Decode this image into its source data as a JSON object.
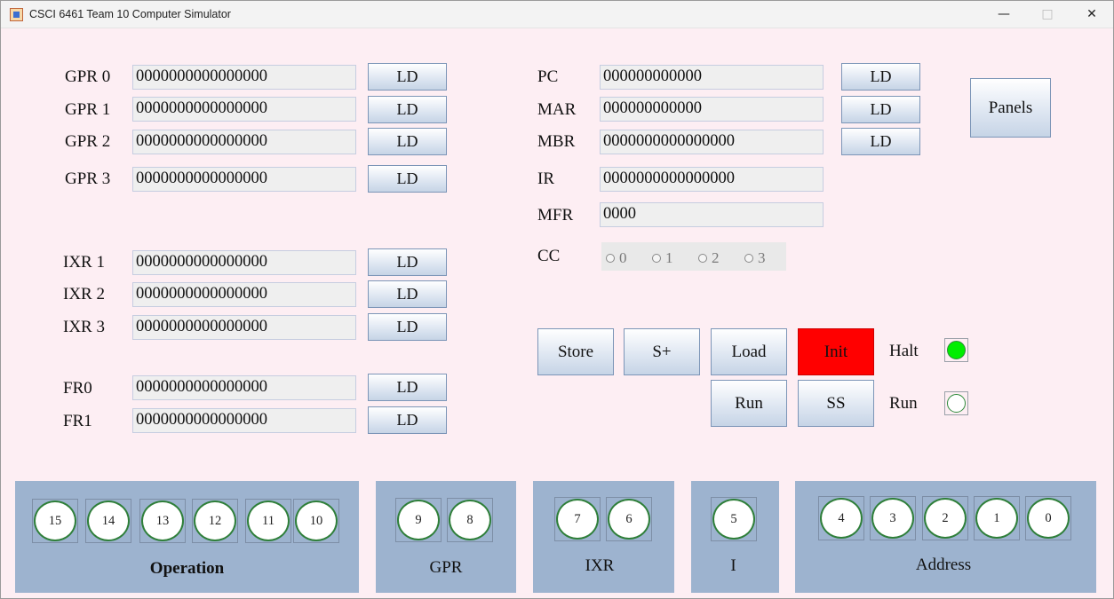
{
  "window": {
    "title": "CSCI 6461 Team 10 Computer Simulator"
  },
  "window_controls": {
    "minimize": "—",
    "maximize": "□",
    "close": "✕"
  },
  "registers_left": [
    {
      "label": "GPR 0",
      "value": "0000000000000000",
      "button": "LD"
    },
    {
      "label": "GPR 1",
      "value": "0000000000000000",
      "button": "LD"
    },
    {
      "label": "GPR 2",
      "value": "0000000000000000",
      "button": "LD"
    },
    {
      "label": "GPR 3",
      "value": "0000000000000000",
      "button": "LD"
    },
    {
      "label": "IXR 1",
      "value": "0000000000000000",
      "button": "LD"
    },
    {
      "label": "IXR 2",
      "value": "0000000000000000",
      "button": "LD"
    },
    {
      "label": "IXR 3",
      "value": "0000000000000000",
      "button": "LD"
    },
    {
      "label": "FR0",
      "value": "0000000000000000",
      "button": "LD"
    },
    {
      "label": "FR1",
      "value": "0000000000000000",
      "button": "LD"
    }
  ],
  "registers_right": [
    {
      "label": "PC",
      "value": "000000000000",
      "button": "LD"
    },
    {
      "label": "MAR",
      "value": "000000000000",
      "button": "LD"
    },
    {
      "label": "MBR",
      "value": "0000000000000000",
      "button": "LD"
    },
    {
      "label": "IR",
      "value": "0000000000000000"
    },
    {
      "label": "MFR",
      "value": "0000"
    }
  ],
  "cc": {
    "label": "CC",
    "options": [
      "0",
      "1",
      "2",
      "3"
    ]
  },
  "panels_button": "Panels",
  "controls": {
    "store": "Store",
    "sp": "S+",
    "load": "Load",
    "init": "Init",
    "run": "Run",
    "ss": "SS"
  },
  "indicators": {
    "halt": {
      "label": "Halt",
      "on": true,
      "color": "#00ee00"
    },
    "run": {
      "label": "Run",
      "on": false,
      "color": "#ffffff"
    }
  },
  "switch_panels": [
    {
      "caption": "Operation",
      "bits": [
        "15",
        "14",
        "13",
        "12",
        "11",
        "10"
      ]
    },
    {
      "caption": "GPR",
      "bits": [
        "9",
        "8"
      ]
    },
    {
      "caption": "IXR",
      "bits": [
        "7",
        "6"
      ]
    },
    {
      "caption": "I",
      "bits": [
        "5"
      ]
    },
    {
      "caption": "Address",
      "bits": [
        "4",
        "3",
        "2",
        "1",
        "0"
      ]
    }
  ]
}
